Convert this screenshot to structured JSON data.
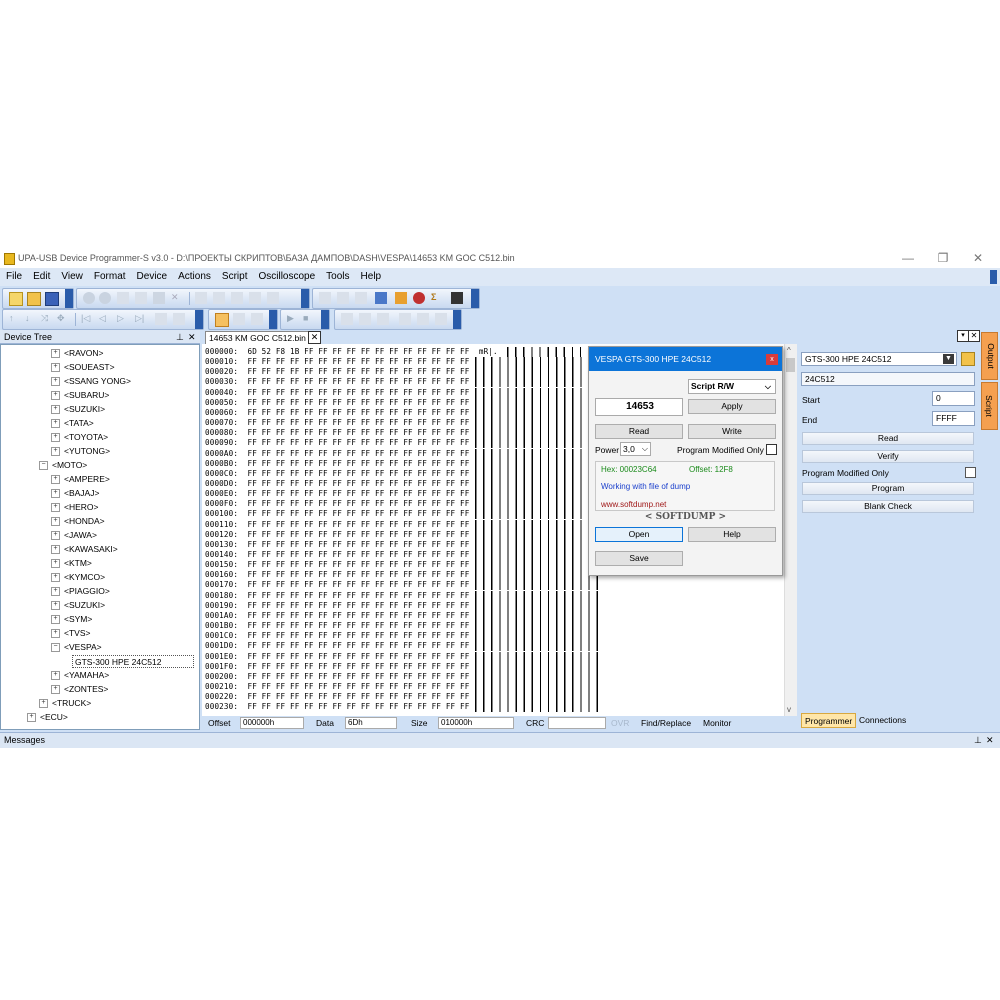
{
  "window": {
    "title": "UPA-USB Device Programmer-S v3.0 - D:\\ПРОЕКТЫ СКРИПТОВ\\БАЗА ДАМПОВ\\DASH\\VESPA\\14653 KM GOC C512.bin",
    "minimize": "—",
    "restore": "❐",
    "close": "✕"
  },
  "menu": [
    "File",
    "Edit",
    "View",
    "Format",
    "Device",
    "Actions",
    "Script",
    "Oscilloscope",
    "Tools",
    "Help"
  ],
  "device_tree": {
    "header": "Device Tree",
    "pin": "⊥",
    "close": "✕",
    "nodes": [
      {
        "label": "<RAVON>",
        "box": "+"
      },
      {
        "label": "<SOUEAST>",
        "box": "+"
      },
      {
        "label": "<SSANG YONG>",
        "box": "+"
      },
      {
        "label": "<SUBARU>",
        "box": "+"
      },
      {
        "label": "<SUZUKI>",
        "box": "+"
      },
      {
        "label": "<TATA>",
        "box": "+"
      },
      {
        "label": "<TOYOTA>",
        "box": "+"
      },
      {
        "label": "<YUTONG>",
        "box": "+"
      },
      {
        "label": "<MOTO>",
        "box": "−"
      },
      {
        "label": "<AMPERE>",
        "box": "+"
      },
      {
        "label": "<BAJAJ>",
        "box": "+"
      },
      {
        "label": "<HERO>",
        "box": "+"
      },
      {
        "label": "<HONDA>",
        "box": "+"
      },
      {
        "label": "<JAWA>",
        "box": "+"
      },
      {
        "label": "<KAWASAKI>",
        "box": "+"
      },
      {
        "label": "<KTM>",
        "box": "+"
      },
      {
        "label": "<KYMCO>",
        "box": "+"
      },
      {
        "label": "<PIAGGIO>",
        "box": "+"
      },
      {
        "label": "<SUZUKI>",
        "box": "+"
      },
      {
        "label": "<SYM>",
        "box": "+"
      },
      {
        "label": "<TVS>",
        "box": "+"
      },
      {
        "label": "<VESPA>",
        "box": "−"
      },
      {
        "label": "GTS-300 HPE 24C512",
        "box": ""
      },
      {
        "label": "<YAMAHA>",
        "box": "+"
      },
      {
        "label": "<ZONTES>",
        "box": "+"
      },
      {
        "label": "<TRUCK>",
        "box": "+"
      },
      {
        "label": "<ECU>",
        "box": "+"
      }
    ]
  },
  "editor": {
    "tab_label": "14653 KM GOC C512.bin",
    "tab_close": "✕",
    "hex_lines": [
      "000000:  6D 52 F8 1B FF FF FF FF FF FF FF FF FF FF FF FF  mR|.",
      "000010:  FF FF FF FF FF FF FF FF FF FF FF FF FF FF FF FF",
      "000020:  FF FF FF FF FF FF FF FF FF FF FF FF FF FF FF FF",
      "000030:  FF FF FF FF FF FF FF FF FF FF FF FF FF FF FF FF",
      "000040:  FF FF FF FF FF FF FF FF FF FF FF FF FF FF FF FF",
      "000050:  FF FF FF FF FF FF FF FF FF FF FF FF FF FF FF FF",
      "000060:  FF FF FF FF FF FF FF FF FF FF FF FF FF FF FF FF",
      "000070:  FF FF FF FF FF FF FF FF FF FF FF FF FF FF FF FF",
      "000080:  FF FF FF FF FF FF FF FF FF FF FF FF FF FF FF FF",
      "000090:  FF FF FF FF FF FF FF FF FF FF FF FF FF FF FF FF",
      "0000A0:  FF FF FF FF FF FF FF FF FF FF FF FF FF FF FF FF",
      "0000B0:  FF FF FF FF FF FF FF FF FF FF FF FF FF FF FF FF",
      "0000C0:  FF FF FF FF FF FF FF FF FF FF FF FF FF FF FF FF",
      "0000D0:  FF FF FF FF FF FF FF FF FF FF FF FF FF FF FF FF",
      "0000E0:  FF FF FF FF FF FF FF FF FF FF FF FF FF FF FF FF",
      "0000F0:  FF FF FF FF FF FF FF FF FF FF FF FF FF FF FF FF",
      "000100:  FF FF FF FF FF FF FF FF FF FF FF FF FF FF FF FF",
      "000110:  FF FF FF FF FF FF FF FF FF FF FF FF FF FF FF FF",
      "000120:  FF FF FF FF FF FF FF FF FF FF FF FF FF FF FF FF",
      "000130:  FF FF FF FF FF FF FF FF FF FF FF FF FF FF FF FF",
      "000140:  FF FF FF FF FF FF FF FF FF FF FF FF FF FF FF FF",
      "000150:  FF FF FF FF FF FF FF FF FF FF FF FF FF FF FF FF",
      "000160:  FF FF FF FF FF FF FF FF FF FF FF FF FF FF FF FF",
      "000170:  FF FF FF FF FF FF FF FF FF FF FF FF FF FF FF FF",
      "000180:  FF FF FF FF FF FF FF FF FF FF FF FF FF FF FF FF",
      "000190:  FF FF FF FF FF FF FF FF FF FF FF FF FF FF FF FF",
      "0001A0:  FF FF FF FF FF FF FF FF FF FF FF FF FF FF FF FF",
      "0001B0:  FF FF FF FF FF FF FF FF FF FF FF FF FF FF FF FF",
      "0001C0:  FF FF FF FF FF FF FF FF FF FF FF FF FF FF FF FF",
      "0001D0:  FF FF FF FF FF FF FF FF FF FF FF FF FF FF FF FF",
      "0001E0:  FF FF FF FF FF FF FF FF FF FF FF FF FF FF FF FF",
      "0001F0:  FF FF FF FF FF FF FF FF FF FF FF FF FF FF FF FF",
      "000200:  FF FF FF FF FF FF FF FF FF FF FF FF FF FF FF FF",
      "000210:  FF FF FF FF FF FF FF FF FF FF FF FF FF FF FF FF",
      "000220:  FF FF FF FF FF FF FF FF FF FF FF FF FF FF FF FF",
      "000230:  FF FF FF FF FF FF FF FF FF FF FF FF FF FF FF FF"
    ],
    "status": {
      "offset_label": "Offset",
      "offset_value": "000000h",
      "data_label": "Data",
      "data_value": "6Dh",
      "size_label": "Size",
      "size_value": "010000h",
      "crc_label": "CRC",
      "crc_value": "",
      "ovr_label": "OVR",
      "find_replace": "Find/Replace",
      "monitor": "Monitor"
    }
  },
  "dialog": {
    "title": "VESPA GTS-300 HPE 24C512",
    "close": "x",
    "mode_select": "Script R/W",
    "value": "14653",
    "apply": "Apply",
    "read": "Read",
    "write": "Write",
    "power_label": "Power",
    "power_value": "3,0",
    "program_modified_only": "Program Modified Only",
    "hex_info": "Hex: 00023C64",
    "offset_info": "Offset: 12F8",
    "working_text": "Working with file of dump",
    "website": "www.softdump.net",
    "brand": "< SOFTDUMP >",
    "open": "Open",
    "help": "Help",
    "save": "Save",
    "colors": {
      "green": "#1a8a1a",
      "blue": "#1a3fcc",
      "red": "#a01818"
    }
  },
  "programmer": {
    "device_select": "GTS-300 HPE 24C512",
    "chip": "24C512",
    "start_label": "Start",
    "start_value": "0",
    "end_label": "End",
    "end_value": "FFFF",
    "read": "Read",
    "verify": "Verify",
    "program_modified_only": "Program Modified Only",
    "program": "Program",
    "blank_check": "Blank Check",
    "tabs": [
      "Programmer",
      "Connections"
    ],
    "side_tabs": [
      "Output",
      "Script"
    ]
  },
  "messages": {
    "label": "Messages",
    "pin": "⊥",
    "close": "✕"
  }
}
